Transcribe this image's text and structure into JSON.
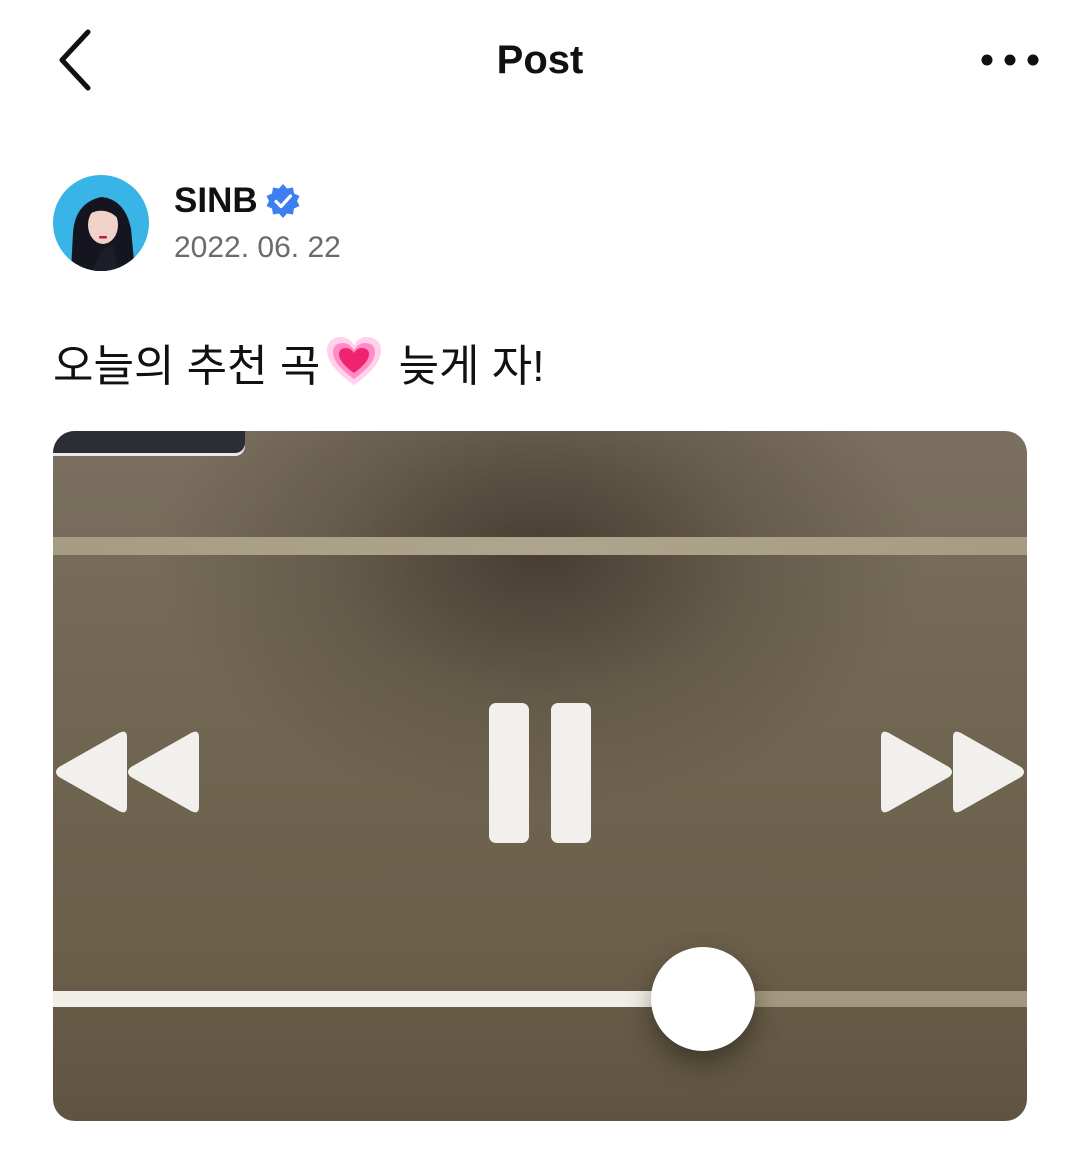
{
  "header": {
    "title": "Post",
    "back_icon": "chevron-left-icon",
    "more_icon": "more-horizontal-icon"
  },
  "post": {
    "author": {
      "name": "SINB",
      "verified": true,
      "verified_color": "#3d7ff0",
      "avatar_bg": "#39b4e6"
    },
    "date": "2022. 06. 22",
    "text_part1": "오늘의 추천 곡",
    "emoji": "💗",
    "text_part2": " 늦게 자!"
  },
  "media": {
    "player": {
      "state": "playing",
      "progress": 0.667,
      "controls": [
        "rewind-icon",
        "pause-icon",
        "fast-forward-icon"
      ]
    }
  }
}
